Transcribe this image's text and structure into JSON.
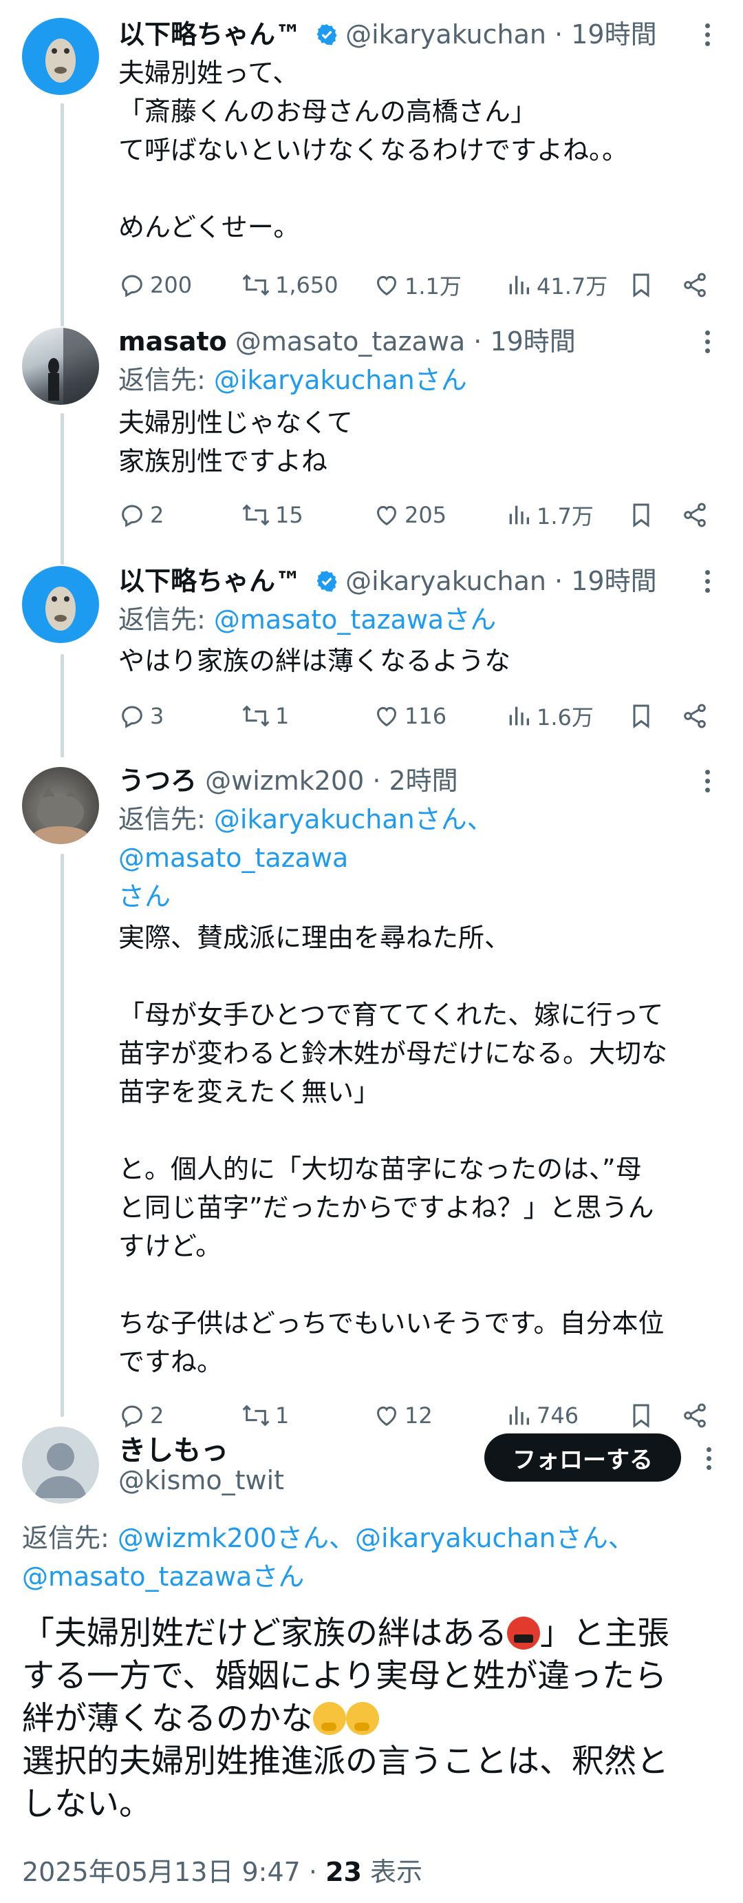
{
  "tweets": [
    {
      "name": "以下略ちゃん™",
      "handle": "@ikaryakuchan",
      "time": "19時間",
      "reply_to_label": "",
      "reply_to": "",
      "text": "夫婦別姓って、\n「斎藤くんのお母さんの高橋さん」\nて呼ばないといけなくなるわけですよね。。\n\nめんどくせー。",
      "replies": "200",
      "retweets": "1,650",
      "likes": "1.1万",
      "views": "41.7万"
    },
    {
      "name": "masato",
      "handle": "@masato_tazawa",
      "time": "19時間",
      "reply_to_label": "返信先: ",
      "reply_to": "@ikaryakuchanさん",
      "text": "夫婦別性じゃなくて\n家族別性ですよね",
      "replies": "2",
      "retweets": "15",
      "likes": "205",
      "views": "1.7万"
    },
    {
      "name": "以下略ちゃん™",
      "handle": "@ikaryakuchan",
      "time": "19時間",
      "reply_to_label": "返信先: ",
      "reply_to": "@masato_tazawaさん",
      "text": "やはり家族の絆は薄くなるような",
      "replies": "3",
      "retweets": "1",
      "likes": "116",
      "views": "1.6万"
    },
    {
      "name": "うつろ",
      "handle": "@wizmk200",
      "time": "2時間",
      "reply_to_label": "返信先: ",
      "reply_to": "@ikaryakuchanさん、@masato_tazawa\nさん",
      "text": "実際、賛成派に理由を尋ねた所、\n\n「母が女手ひとつで育ててくれた、嫁に行って\n苗字が変わると鈴木姓が母だけになる。大切な\n苗字を変えたく無い」\n\nと。個人的に「大切な苗字になったのは、”母\nと同じ苗字”だったからですよね？」と思うん\nすけど。\n\nちな子供はどっちでもいいそうです。自分本位\nですね。",
      "replies": "2",
      "retweets": "1",
      "likes": "12",
      "views": "746"
    }
  ],
  "focal": {
    "name": "きしもっ",
    "handle": "@kismo_twit",
    "follow_label": "フォローする",
    "reply_to_label": "返信先: ",
    "reply_to": "@wizmk200さん、@ikaryakuchanさん、\n@masato_tazawaさん",
    "text_part1": "「夫婦別姓だけど家族の絆はある",
    "text_part2": "」と主張\nする一方で、婚姻により実母と姓が違ったら\n絆が薄くなるのかな",
    "text_part3": "\n選択的夫婦別姓推進派の言うことは、釈然と\nしない。",
    "timestamp": "2025年05月13日 9:47",
    "separator": " · ",
    "views_count": "23",
    "views_label": " 表示"
  },
  "icons": {
    "reply": "reply-icon",
    "retweet": "retweet-icon",
    "like": "heart-icon",
    "views": "views-icon",
    "bookmark": "bookmark-icon",
    "share": "share-icon",
    "verified": "verified-badge-icon",
    "more": "more-icon"
  },
  "colors": {
    "accent": "#1d9bf0",
    "text": "#0f1419",
    "secondary": "#536471",
    "thread_line": "#cfd9de"
  }
}
